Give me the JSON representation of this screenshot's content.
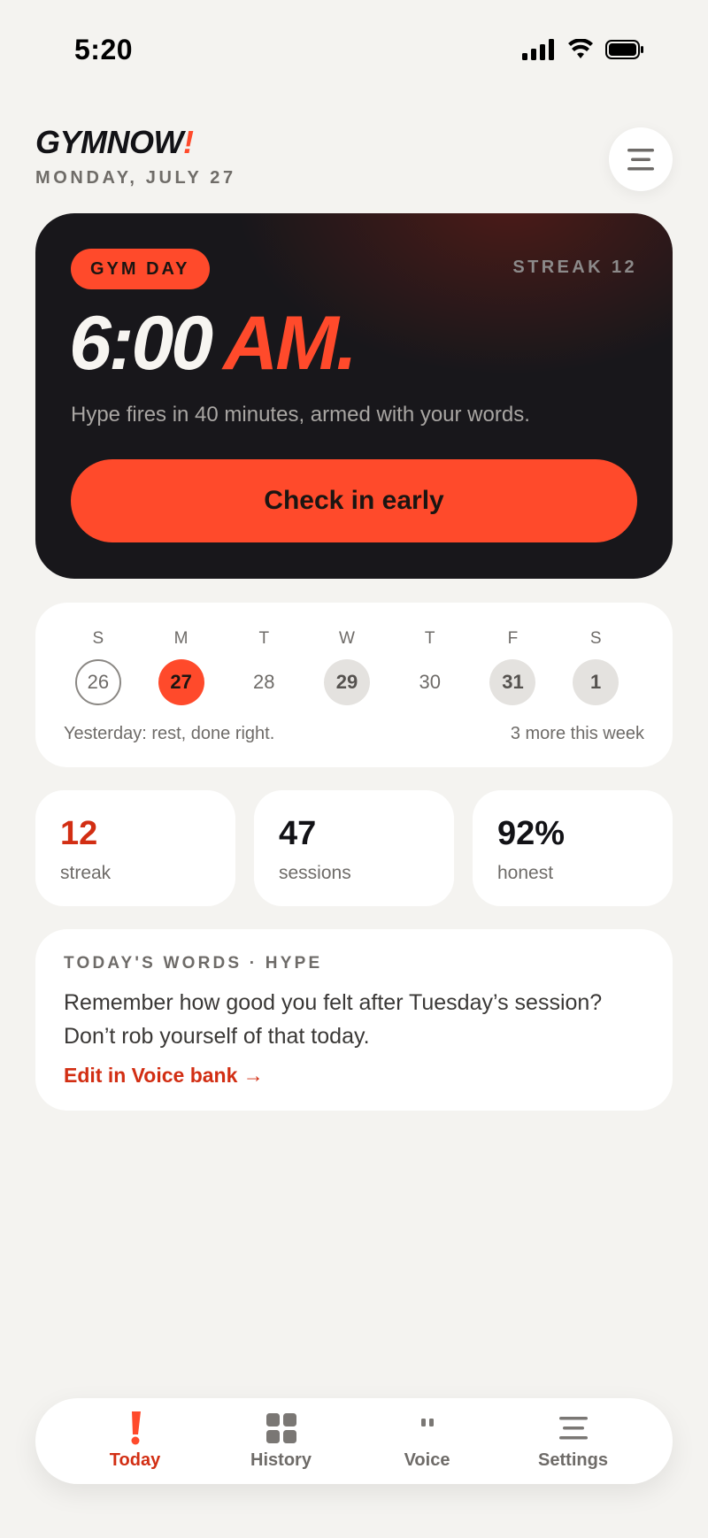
{
  "status_bar": {
    "time": "5:20"
  },
  "header": {
    "brand": "GYMNOW",
    "brand_accent": "!",
    "date": "MONDAY, JULY 27",
    "menu_icon": "hamburger-icon"
  },
  "hero": {
    "badge": "GYM DAY",
    "streak": "STREAK 12",
    "time": "6:00",
    "ampm": "AM.",
    "subtitle": "Hype fires in 40 minutes, armed with your words.",
    "button": "Check in early"
  },
  "week": {
    "days": [
      {
        "letter": "S",
        "num": "26",
        "state": "past"
      },
      {
        "letter": "M",
        "num": "27",
        "state": "today"
      },
      {
        "letter": "T",
        "num": "28",
        "state": "rest"
      },
      {
        "letter": "W",
        "num": "29",
        "state": "planned"
      },
      {
        "letter": "T",
        "num": "30",
        "state": "rest"
      },
      {
        "letter": "F",
        "num": "31",
        "state": "planned"
      },
      {
        "letter": "S",
        "num": "1",
        "state": "planned"
      }
    ],
    "note_left": "Yesterday: rest, done right.",
    "note_right": "3 more this week"
  },
  "stats": [
    {
      "value": "12",
      "label": "streak"
    },
    {
      "value": "47",
      "label": "sessions"
    },
    {
      "value": "92%",
      "label": "honest"
    }
  ],
  "words": {
    "label": "TODAY'S WORDS · HYPE",
    "quote": "Remember how good you felt after Tuesday’s session? Don’t rob yourself of that today.",
    "link": "Edit in Voice bank →"
  },
  "tabs": [
    {
      "label": "Today",
      "icon": "exclamation-icon"
    },
    {
      "label": "History",
      "icon": "grid-icon"
    },
    {
      "label": "Voice",
      "icon": "quote-icon"
    },
    {
      "label": "Settings",
      "icon": "menu-lines-icon"
    }
  ],
  "colors": {
    "accent": "#ff4a2b",
    "accent_text": "#d22e13",
    "hero_bg": "#18171b",
    "page_bg": "#f4f3f0"
  }
}
